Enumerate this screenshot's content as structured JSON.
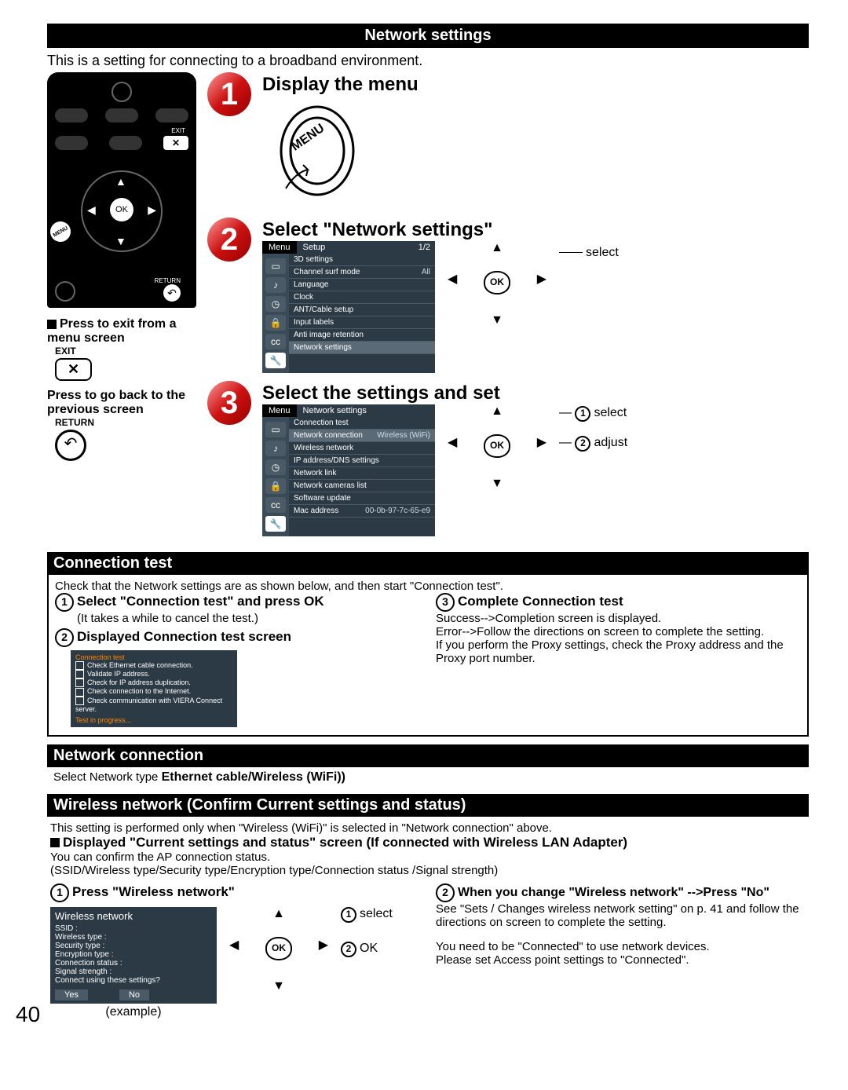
{
  "pageNumber": "40",
  "titleBar": "Network settings",
  "intro": "This is a setting for connecting to a broadband environment.",
  "remote": {
    "exitSmallLabel": "EXIT",
    "okLabel": "OK",
    "returnSmallLabel": "RETURN",
    "menuBadge": "MENU"
  },
  "hints": {
    "exitTitle": "Press to exit from a menu screen",
    "exitLabel": "EXIT",
    "backTitle": "Press to go back to the previous screen",
    "returnLabel": "RETURN"
  },
  "step1": {
    "num": "1",
    "title": "Display the menu",
    "buttonWord": "MENU"
  },
  "step2": {
    "num": "2",
    "title": "Select \"Network settings\"",
    "menuTab": "Menu",
    "setupTab": "Setup",
    "page": "1/2",
    "items": [
      "3D settings",
      "Channel surf mode",
      "Language",
      "Clock",
      "ANT/Cable setup",
      "Input labels",
      "Anti image retention",
      "Network settings"
    ],
    "surfValue": "All",
    "dpadLabel": "select",
    "ok": "OK"
  },
  "step3": {
    "num": "3",
    "title": "Select the settings and set",
    "menuTab": "Menu",
    "netTab": "Network settings",
    "items": [
      "Connection test",
      "Network connection",
      "Wireless network",
      "IP address/DNS settings",
      "Network link",
      "Network cameras list",
      "Software update",
      "Mac address"
    ],
    "netConnVal": "Wireless (WiFi)",
    "macVal": "00-0b-97-7c-65-e9",
    "label1": "select",
    "label2": "adjust",
    "ok": "OK"
  },
  "connTest": {
    "bar": "Connection test",
    "intro": "Check that the Network settings are as shown below, and then start \"Connection test\".",
    "s1": "Select \"Connection test\" and press OK",
    "s1note": "(It takes a while to cancel the test.)",
    "s2": "Displayed Connection test screen",
    "box": {
      "title": "Connection test",
      "lines": [
        "Check Ethernet cable connection.",
        "Validate IP address.",
        "Check for IP address duplication.",
        "Check connection to the Internet.",
        "Check communication with VIERA Connect server."
      ],
      "progress": "Test in progress..."
    },
    "s3": "Complete Connection test",
    "r1": "Success-->Completion screen is displayed.",
    "r2": "Error-->Follow the directions on screen to complete the setting.",
    "r3": "If you perform the Proxy settings, check the Proxy address and the Proxy port number."
  },
  "netConn": {
    "bar": "Network connection",
    "line": "Select Network type ",
    "bold": "Ethernet cable/Wireless (WiFi))"
  },
  "wireless": {
    "bar": "Wireless network (Confirm Current settings and status)",
    "line1": "This setting is performed only when \"Wireless (WiFi)\" is selected in \"Network connection\" above.",
    "line2": "Displayed \"Current settings and status\" screen (If connected with Wireless LAN Adapter)",
    "line3": "You can confirm the AP connection status.",
    "line4": "(SSID/Wireless type/Security type/Encryption type/Connection status /Signal strength)",
    "s1": "Press \"Wireless network\"",
    "box": {
      "title": "Wireless network",
      "rows": [
        "SSID :",
        "Wireless type :",
        "Security type :",
        "Encryption type :",
        "Connection status :",
        "Signal strength :",
        "Connect using these settings?"
      ],
      "yes": "Yes",
      "no": "No"
    },
    "exampleLabel": "(example)",
    "dpadSel": "select",
    "dpadOk": "OK",
    "ok": "OK",
    "s2": "When you change \"Wireless network\" -->Press \"No\"",
    "r1": "See \"Sets / Changes wireless network setting\" on p. 41 and follow the directions on screen to complete the setting.",
    "r2": "You need to be \"Connected\" to use network devices.",
    "r3": "Please set Access point settings to \"Connected\"."
  }
}
